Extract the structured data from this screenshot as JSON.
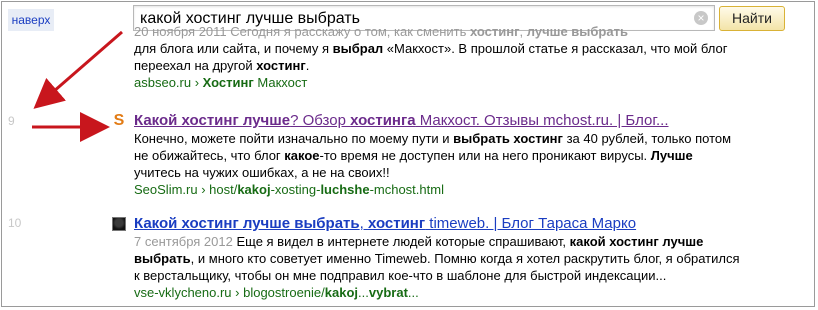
{
  "up_link": "наверх",
  "search": {
    "value": "какой хостинг лучше выбрать",
    "clear_glyph": "×",
    "button_label": "Найти"
  },
  "results": [
    {
      "number": "",
      "snippet_line1_date": "20 ноября 2011",
      "snippet_line1_text": " Сегодня я расскажу о том, как сменить ",
      "snippet_line1_b1": "хостинг",
      "snippet_line1_t2": ", ",
      "snippet_line1_b2": "лучше выбрать",
      "snippet_line2_t1": "для блога или сайта, и почему я ",
      "snippet_line2_b1": "выбрал",
      "snippet_line2_t2": " «Макхост». В прошлой статье я рассказал, что мой блог",
      "snippet_line3_t1": "переехал на другой ",
      "snippet_line3_b1": "хостинг",
      "snippet_line3_t2": ".",
      "url_domain": "asbseo.ru",
      "url_sep": " › ",
      "url_b": "Хостинг",
      "url_rest": " Макхост"
    },
    {
      "number": "9",
      "title_b1": "Какой хостинг лучше",
      "title_t1": "? Обзор ",
      "title_b2": "хостинга",
      "title_t2": " Макхост. Отзывы mchost.ru. | Блог...",
      "s1_t1": "Конечно, можете пойти изначально по моему пути и ",
      "s1_b1": "выбрать хостинг",
      "s1_t2": " за 40 рублей, только потом",
      "s2_t1": "не обижайтесь, что блог ",
      "s2_b1": "какое",
      "s2_t2": "-то время не доступен или на него проникают вирусы. ",
      "s2_b2": "Лучше",
      "s3_t1": "учитесь на чужих ошибках, а не на своих!!",
      "s3_b1": "",
      "s3_t2": "",
      "url_domain": "SeoSlim.ru",
      "url_rest1": " › host/",
      "url_b1": "kakoj",
      "url_rest2": "-xosting-",
      "url_b2": "luchshe",
      "url_rest3": "-mchost.html",
      "favicon": "S"
    },
    {
      "number": "10",
      "title_b1": "Какой хостинг лучше выбрать",
      "title_t1": ", ",
      "title_b2": "хостинг",
      "title_t2": " timeweb. | Блог Тараса Марко",
      "date": "7 сентября 2012",
      "s1_t1": "  Еще я видел в интернете людей которые спрашивают, ",
      "s1_b1": "какой хостинг лучше",
      "s2_b1": "выбрать",
      "s2_t1": ", и много кто советует именно Timeweb. Помню когда я хотел раскрутить блог, я обратился",
      "s3_t1": "к верстальщику, чтобы он мне подправил кое-что в шаблоне для быстрой индексации...",
      "url_domain": "vse-vklycheno.ru",
      "url_rest1": " › blogostroenie/",
      "url_b1": "kakoj",
      "url_rest2": "...",
      "url_b2": "vybrat",
      "url_rest3": "..."
    }
  ],
  "annotation_color": "#c8161d"
}
